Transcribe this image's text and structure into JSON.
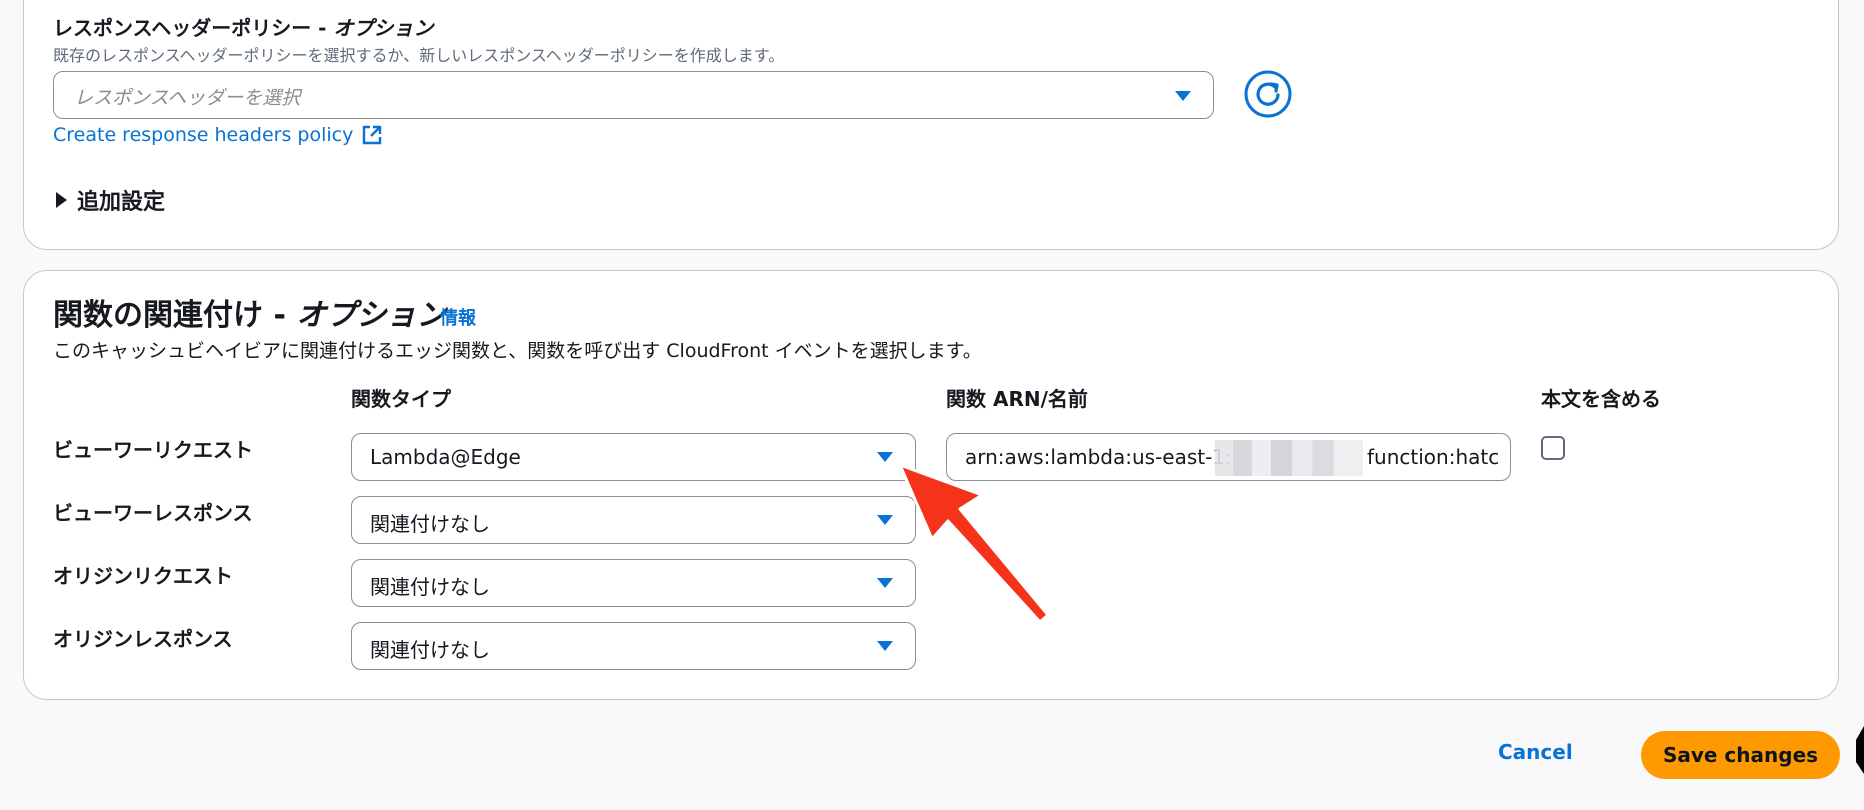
{
  "response_headers": {
    "label": "レスポンスヘッダーポリシー - ",
    "label_optional": "オプション",
    "description": "既存のレスポンスヘッダーポリシーを選択するか、新しいレスポンスヘッダーポリシーを作成します。",
    "select_placeholder": "レスポンスヘッダーを選択",
    "create_link": "Create response headers policy",
    "refresh_icon": "refresh-icon",
    "external_icon": "external-link-icon"
  },
  "additional_settings": {
    "label": "追加設定"
  },
  "function_associations": {
    "title": "関数の関連付け - ",
    "title_optional": "オプション",
    "info_link": "情報",
    "description": "このキャッシュビヘイビアに関連付けるエッジ関数と、関数を呼び出す CloudFront イベントを選択します。",
    "columns": {
      "function_type": "関数タイプ",
      "function_arn": "関数 ARN/名前",
      "include_body": "本文を含める"
    },
    "rows": [
      {
        "label": "ビューワーリクエスト",
        "function_type": "Lambda@Edge"
      },
      {
        "label": "ビューワーレスポンス",
        "function_type": "関連付けなし"
      },
      {
        "label": "オリジンリクエスト",
        "function_type": "関連付けなし"
      },
      {
        "label": "オリジンレスポンス",
        "function_type": "関連付けなし"
      }
    ],
    "arn_value_prefix": "arn:aws:lambda:us-east-1:",
    "arn_value_suffix": "function:hatc",
    "include_body_checked": false
  },
  "footer": {
    "cancel_label": "Cancel",
    "save_label": "Save changes"
  },
  "colors": {
    "link": "#0972d3",
    "primary_button": "#ff9900",
    "annotation_arrow": "#f5331a"
  }
}
